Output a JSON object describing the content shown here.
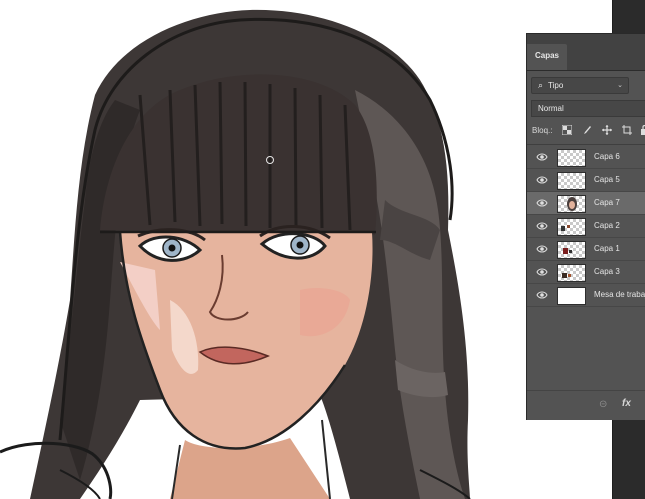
{
  "canvas": {
    "description_icon": "artwork"
  },
  "layers_panel": {
    "tab_label": "Capas",
    "filter": {
      "glyph": "⌕",
      "label": "Tipo",
      "chevron": "⌄"
    },
    "blend_mode": "Normal",
    "lock_label": "Bloq.:",
    "lock_icons": [
      "checkerboard-lock-icon",
      "brush-lock-icon",
      "move-lock-icon",
      "artboard-lock-icon",
      "padlock-icon"
    ],
    "layers": [
      {
        "name": "Capa 6",
        "thumb": "transparent",
        "selected": false
      },
      {
        "name": "Capa 5",
        "thumb": "transparent",
        "selected": false
      },
      {
        "name": "Capa 7",
        "thumb": "portrait",
        "selected": true
      },
      {
        "name": "Capa 2",
        "thumb": "dark-bits",
        "selected": false
      },
      {
        "name": "Capa 1",
        "thumb": "red-bits",
        "selected": false
      },
      {
        "name": "Capa 3",
        "thumb": "dark-bits",
        "selected": false
      },
      {
        "name": "Mesa de trabajo",
        "thumb": "white",
        "selected": false
      }
    ],
    "footer": {
      "link_icon": "⊝",
      "fx_label": "fx"
    }
  },
  "colors": {
    "panel_bg": "#535353",
    "selected_row": "#6a6a6a",
    "tab_bar": "#424242"
  }
}
